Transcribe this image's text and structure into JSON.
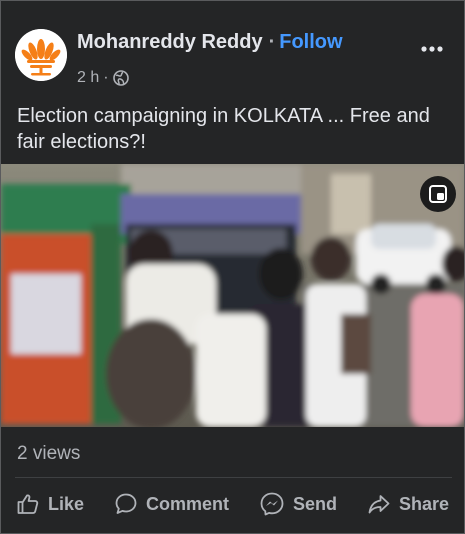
{
  "post": {
    "author": "Mohanreddy Reddy",
    "follow_label": "Follow",
    "time": "2 h",
    "meta_separator": "·",
    "privacy_icon": "globe-icon",
    "caption": "Election campaigning in KOLKATA ... Free and fair elections?!",
    "views": "2 views"
  },
  "actions": {
    "like": "Like",
    "comment": "Comment",
    "send": "Send",
    "share": "Share"
  },
  "icons": {
    "more": "more-options-icon",
    "pip": "picture-in-picture-icon",
    "like": "thumbs-up-icon",
    "comment": "comment-bubble-icon",
    "send": "messenger-icon",
    "share": "share-arrow-icon"
  },
  "colors": {
    "background": "#242526",
    "text": "#e4e6eb",
    "muted": "#b0b3b8",
    "accent": "#4599ff",
    "avatar_logo": "#f57f17"
  }
}
